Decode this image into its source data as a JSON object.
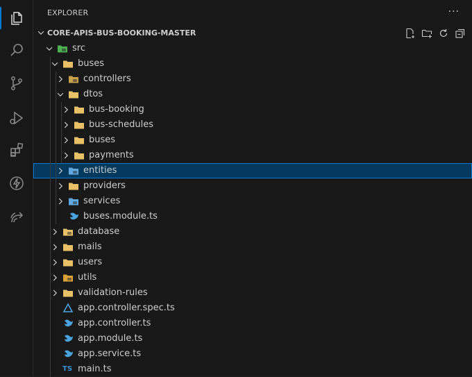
{
  "explorer": {
    "title": "EXPLORER",
    "more_label": "···",
    "project_name": "CORE-APIS-BUS-BOOKING-MASTER",
    "project_actions": [
      "new-file-icon",
      "new-folder-icon",
      "refresh-icon",
      "collapse-all-icon"
    ]
  },
  "activity_bar": [
    "files-icon",
    "search-icon",
    "source-control-icon",
    "run-debug-icon",
    "extensions-icon",
    "lightning-icon",
    "remote-share-icon"
  ],
  "tree": [
    {
      "label": "src",
      "depth": 0,
      "expanded": true,
      "icon": "src-folder-icon",
      "icon_color": "#4caf50"
    },
    {
      "label": "buses",
      "depth": 1,
      "expanded": true,
      "icon": "folder-icon",
      "icon_color": "#e8c067"
    },
    {
      "label": "controllers",
      "depth": 2,
      "expanded": false,
      "icon": "controllers-folder-icon",
      "icon_color": "#c5a04a"
    },
    {
      "label": "dtos",
      "depth": 2,
      "expanded": true,
      "icon": "folder-icon",
      "icon_color": "#e8c067"
    },
    {
      "label": "bus-booking",
      "depth": 3,
      "expanded": false,
      "icon": "folder-icon",
      "icon_color": "#e8c067"
    },
    {
      "label": "bus-schedules",
      "depth": 3,
      "expanded": false,
      "icon": "folder-icon",
      "icon_color": "#e8c067"
    },
    {
      "label": "buses",
      "depth": 3,
      "expanded": false,
      "icon": "folder-icon",
      "icon_color": "#e8c067"
    },
    {
      "label": "payments",
      "depth": 3,
      "expanded": false,
      "icon": "folder-icon",
      "icon_color": "#e8c067"
    },
    {
      "label": "entities",
      "depth": 2,
      "expanded": false,
      "icon": "entities-folder-icon",
      "icon_color": "#5fa8e0",
      "selected": true
    },
    {
      "label": "providers",
      "depth": 2,
      "expanded": false,
      "icon": "folder-icon",
      "icon_color": "#e8c067"
    },
    {
      "label": "services",
      "depth": 2,
      "expanded": false,
      "icon": "services-folder-icon",
      "icon_color": "#5fa8e0"
    },
    {
      "label": "buses.module.ts",
      "depth": 2,
      "file": true,
      "icon": "nest-module-icon",
      "icon_color": "#4aa3df"
    },
    {
      "label": "database",
      "depth": 1,
      "expanded": false,
      "icon": "database-folder-icon",
      "icon_color": "#e8c067"
    },
    {
      "label": "mails",
      "depth": 1,
      "expanded": false,
      "icon": "folder-icon",
      "icon_color": "#e8c067"
    },
    {
      "label": "users",
      "depth": 1,
      "expanded": false,
      "icon": "folder-icon",
      "icon_color": "#e8c067"
    },
    {
      "label": "utils",
      "depth": 1,
      "expanded": false,
      "icon": "utils-folder-icon",
      "icon_color": "#d9a33a"
    },
    {
      "label": "validation-rules",
      "depth": 1,
      "expanded": false,
      "icon": "folder-icon",
      "icon_color": "#e8c067"
    },
    {
      "label": "app.controller.spec.ts",
      "depth": 1,
      "file": true,
      "icon": "spec-file-icon",
      "icon_color": "#4aa3df"
    },
    {
      "label": "app.controller.ts",
      "depth": 1,
      "file": true,
      "icon": "nest-controller-icon",
      "icon_color": "#4aa3df"
    },
    {
      "label": "app.module.ts",
      "depth": 1,
      "file": true,
      "icon": "nest-module-icon",
      "icon_color": "#4aa3df"
    },
    {
      "label": "app.service.ts",
      "depth": 1,
      "file": true,
      "icon": "nest-service-icon",
      "icon_color": "#4aa3df"
    },
    {
      "label": "main.ts",
      "depth": 1,
      "file": true,
      "icon": "typescript-icon",
      "icon_color": "#3b8fd6",
      "icon_text": "TS"
    }
  ]
}
